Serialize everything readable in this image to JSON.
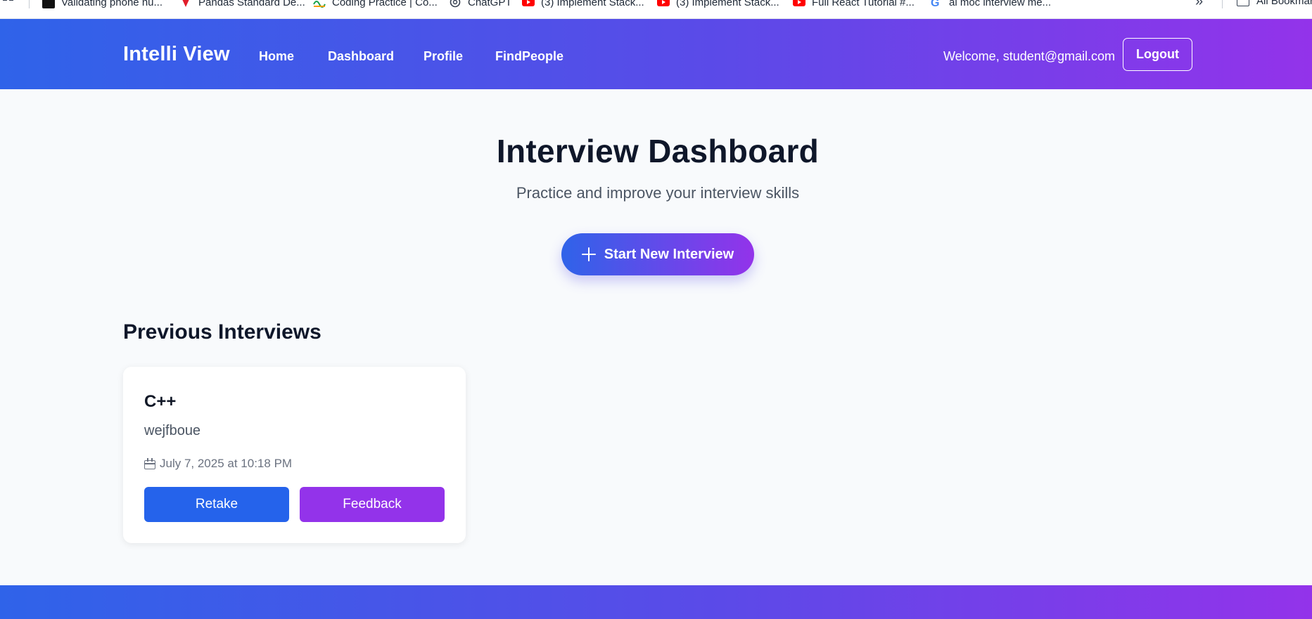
{
  "bookmarks": {
    "items": [
      {
        "label": "Validating phone nu...",
        "icon": "black-square-icon"
      },
      {
        "label": "Pandas Standard De...",
        "icon": "red-pin-icon"
      },
      {
        "label": "Coding Practice | Co...",
        "icon": "coding-practice-icon"
      },
      {
        "label": "ChatGPT",
        "icon": "chatgpt-icon"
      },
      {
        "label": "(3) Implement Stack...",
        "icon": "youtube-icon"
      },
      {
        "label": "(3) Implement Stack...",
        "icon": "youtube-icon"
      },
      {
        "label": "Full React Tutorial #...",
        "icon": "youtube-icon"
      },
      {
        "label": "ai moc interview me...",
        "icon": "google-icon"
      }
    ],
    "overflow_glyph": "»",
    "all_bookmarks_label": "All Bookmarks"
  },
  "header": {
    "brand": "Intelli View",
    "nav": [
      "Home",
      "Dashboard",
      "Profile",
      "FindPeople"
    ],
    "welcome": "Welcome, student@gmail.com",
    "logout_label": "Logout"
  },
  "hero": {
    "title": "Interview Dashboard",
    "subtitle": "Practice and improve your interview skills",
    "start_label": "Start New Interview"
  },
  "previous": {
    "title": "Previous Interviews",
    "cards": [
      {
        "title": "C++",
        "description": "wejfboue",
        "date": "July 7, 2025 at 10:18 PM",
        "retake_label": "Retake",
        "feedback_label": "Feedback"
      }
    ]
  },
  "colors": {
    "gradient_start": "#2f63e9",
    "gradient_end": "#9333ea",
    "retake": "#2563eb",
    "feedback": "#9333ea",
    "background": "#f8fafc"
  }
}
